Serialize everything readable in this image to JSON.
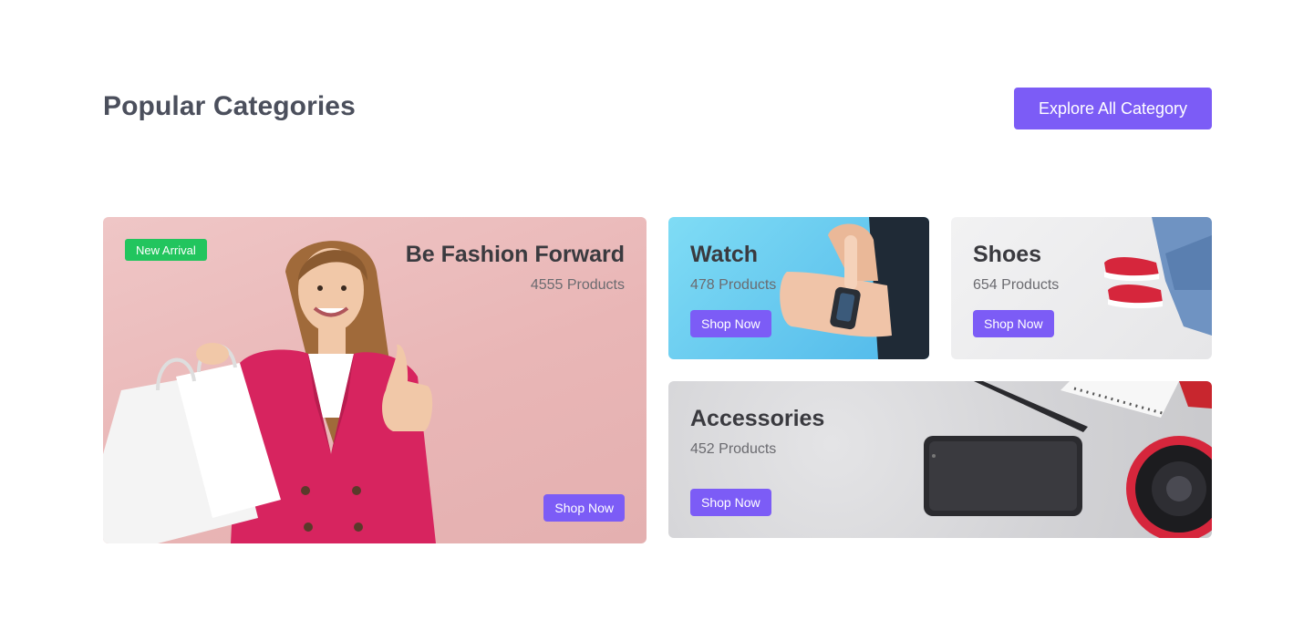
{
  "header": {
    "title": "Popular Categories",
    "explore_label": "Explore All Category"
  },
  "cards": [
    {
      "title": "Be Fashion Forward",
      "count": "4555 Products",
      "badge": "New Arrival",
      "cta": "Shop Now"
    },
    {
      "title": "Watch",
      "count": "478 Products",
      "cta": "Shop Now"
    },
    {
      "title": "Shoes",
      "count": "654 Products",
      "cta": "Shop Now"
    },
    {
      "title": "Accessories",
      "count": "452 Products",
      "cta": "Shop Now"
    }
  ],
  "colors": {
    "accent": "#7c5cf6",
    "badge": "#22c55e",
    "title_text": "#4b4f5c"
  }
}
